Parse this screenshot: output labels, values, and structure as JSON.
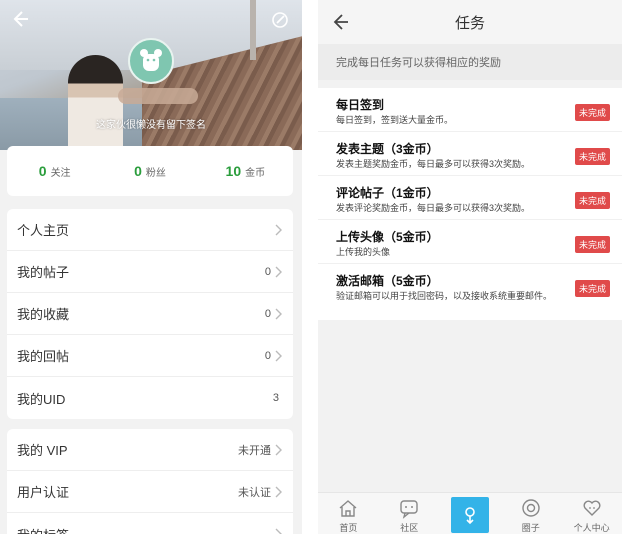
{
  "left": {
    "signature": "这家伙很懒没有留下签名",
    "stats": [
      {
        "count": "0",
        "label": "关注"
      },
      {
        "count": "0",
        "label": "粉丝"
      },
      {
        "count": "10",
        "label": "金币"
      }
    ],
    "menu1": [
      {
        "label": "个人主页",
        "value": ""
      },
      {
        "label": "我的帖子",
        "value": "0"
      },
      {
        "label": "我的收藏",
        "value": "0"
      },
      {
        "label": "我的回帖",
        "value": "0"
      },
      {
        "label": "我的UID",
        "value": "3"
      }
    ],
    "menu2": [
      {
        "label": "我的 VIP",
        "value": "未开通"
      },
      {
        "label": "用户认证",
        "value": "未认证"
      },
      {
        "label": "我的标签",
        "value": ""
      }
    ]
  },
  "right": {
    "title": "任务",
    "notice": "完成每日任务可以获得相应的奖励",
    "tasks": [
      {
        "title": "每日签到",
        "desc": "每日签到，签到送大量金币。",
        "status": "未完成"
      },
      {
        "title": "发表主题（3金币）",
        "desc": "发表主题奖励金币，每日最多可以获得3次奖励。",
        "status": "未完成"
      },
      {
        "title": "评论帖子（1金币）",
        "desc": "发表评论奖励金币，每日最多可以获得3次奖励。",
        "status": "未完成"
      },
      {
        "title": "上传头像（5金币）",
        "desc": "上传我的头像",
        "status": "未完成"
      },
      {
        "title": "激活邮箱（5金币）",
        "desc": "验证邮箱可以用于找回密码，以及接收系统重要邮件。",
        "status": "未完成"
      }
    ],
    "tabs": [
      {
        "label": "首页",
        "icon": "home-icon"
      },
      {
        "label": "社区",
        "icon": "community-icon"
      },
      {
        "label": "",
        "icon": "publish-icon"
      },
      {
        "label": "圈子",
        "icon": "circle-icon"
      },
      {
        "label": "个人中心",
        "icon": "heart-icon"
      }
    ]
  },
  "colors": {
    "accent_green": "#2a9d3c",
    "badge_red": "#e04a4a",
    "tab_center_blue": "#33b3e8"
  }
}
